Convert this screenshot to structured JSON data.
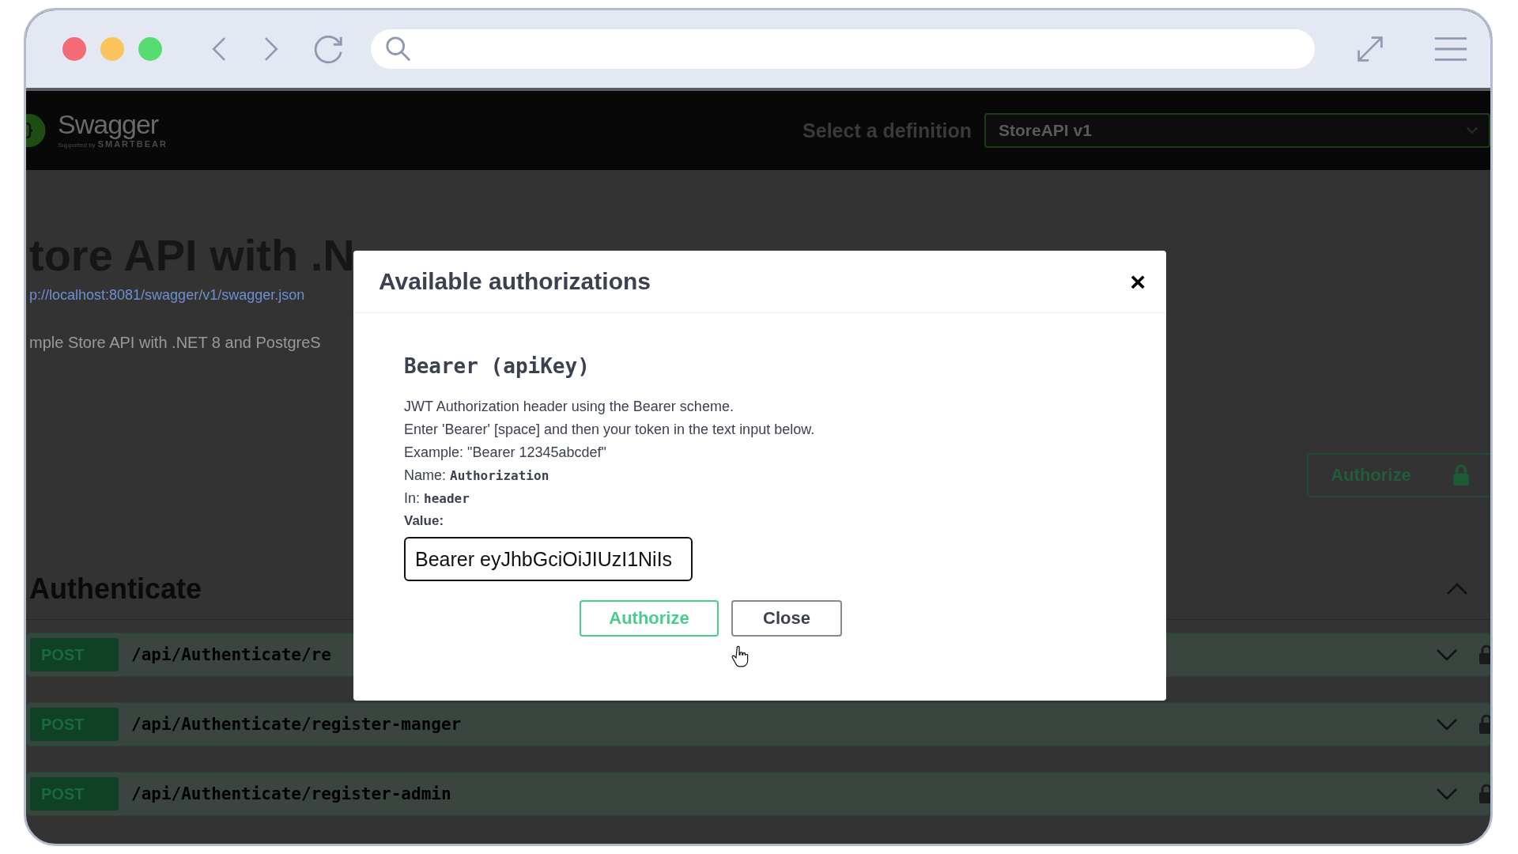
{
  "header": {
    "logo_name": "Swagger",
    "logo_tagline": "Supported by",
    "logo_brand": "SMARTBEAR",
    "definition_label": "Select a definition",
    "definition_value": "StoreAPI v1"
  },
  "info": {
    "title": "tore API with .N",
    "url": "p://localhost:8081/swagger/v1/swagger.json",
    "description": "mple Store API with .NET 8 and PostgreS"
  },
  "authorize_button": {
    "label": "Authorize"
  },
  "section": {
    "title": "Authenticate",
    "expanded": true,
    "operations": [
      {
        "method": "POST",
        "path": "/api/Authenticate/re"
      },
      {
        "method": "POST",
        "path": "/api/Authenticate/register-manger"
      },
      {
        "method": "POST",
        "path": "/api/Authenticate/register-admin"
      }
    ]
  },
  "modal": {
    "title": "Available authorizations",
    "close": "×",
    "scheme_title": "Bearer (apiKey)",
    "description": [
      "JWT Authorization header using the Bearer scheme.",
      "Enter 'Bearer' [space] and then your token in the text input below.",
      "Example: \"Bearer 12345abcdef\""
    ],
    "name_label": "Name:",
    "name_value": "Authorization",
    "in_label": "In:",
    "in_value": "header",
    "value_label": "Value:",
    "value": "Bearer eyJhbGciOiJIUzI1NiIs",
    "buttons": [
      {
        "label": "Authorize",
        "kind": "primary"
      },
      {
        "label": "Close",
        "kind": "secondary"
      }
    ]
  }
}
